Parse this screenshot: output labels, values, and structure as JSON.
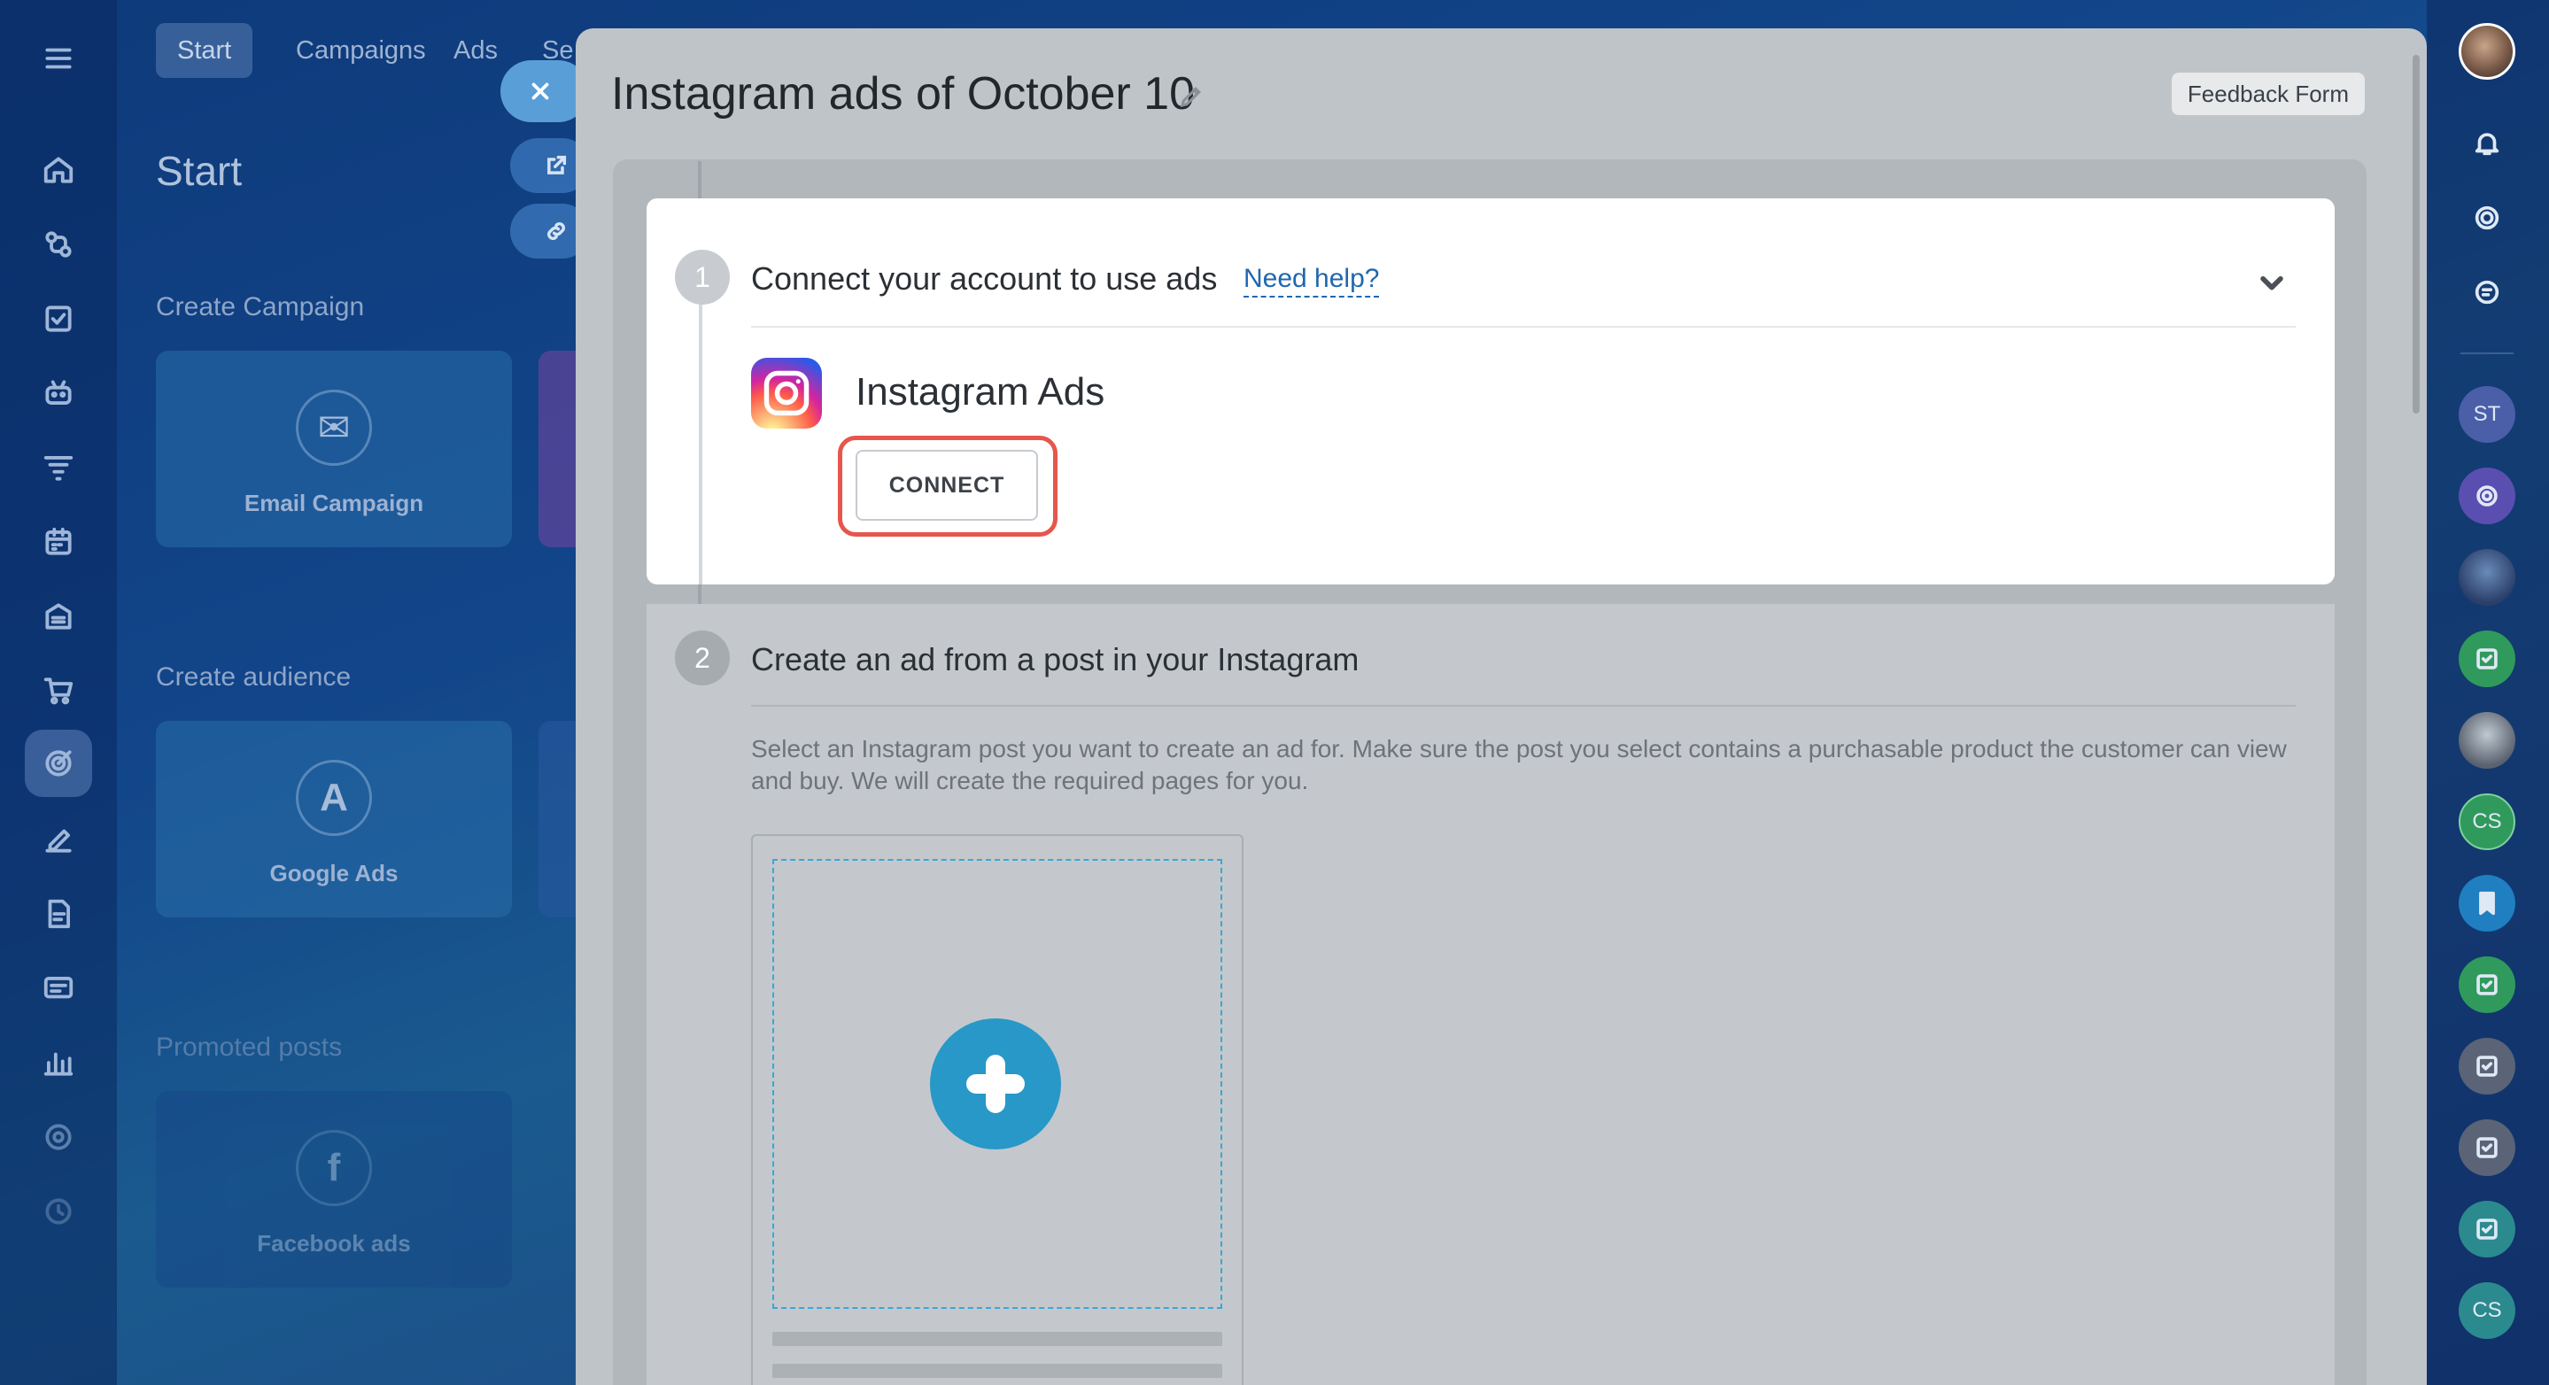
{
  "background_page": {
    "tabs": [
      {
        "label": "Start",
        "active": true
      },
      {
        "label": "Campaigns",
        "active": false
      },
      {
        "label": "Ads",
        "active": false
      },
      {
        "label": "Se",
        "active": false
      }
    ],
    "title": "Start",
    "sections": {
      "create_campaign": "Create Campaign",
      "create_audience": "Create audience",
      "promoted_posts": "Promoted posts"
    },
    "cards": {
      "email": "Email Campaign",
      "google": "Google Ads",
      "facebook": "Facebook ads"
    }
  },
  "left_rail": {
    "icons": [
      "menu-icon",
      "home-icon",
      "crm-icon",
      "tasks-icon",
      "robot-icon",
      "funnel-icon",
      "calendar-icon",
      "inventory-icon",
      "cart-icon",
      "marketing-icon",
      "sign-icon",
      "document-icon",
      "contact-center-icon",
      "analytics-icon",
      "support-icon",
      "apps-icon"
    ],
    "active": "marketing-icon"
  },
  "slider": {
    "title": "Instagram ads of October 10",
    "feedback_label": "Feedback Form",
    "step1": {
      "number": "1",
      "title": "Connect your account to use ads",
      "help_link": "Need help?",
      "provider_name": "Instagram Ads",
      "connect_label": "CONNECT"
    },
    "step2": {
      "number": "2",
      "title": "Create an ad from a post in your Instagram",
      "description": "Select an Instagram post you want to create an ad for. Make sure the post you select contains a purchasable product the customer can view and buy. We will create the required pages for you."
    }
  },
  "right_rail": {
    "avatars": [
      {
        "initials": "ST",
        "color": "#4a5fa8"
      },
      {
        "initials": "CS",
        "color": "#2f9a5c"
      },
      {
        "initials": "CS",
        "color": "#2b8a8e"
      }
    ]
  },
  "colors": {
    "accent_blue": "#2798c8",
    "highlight_red": "#e6564d",
    "link_blue": "#2067b0"
  }
}
